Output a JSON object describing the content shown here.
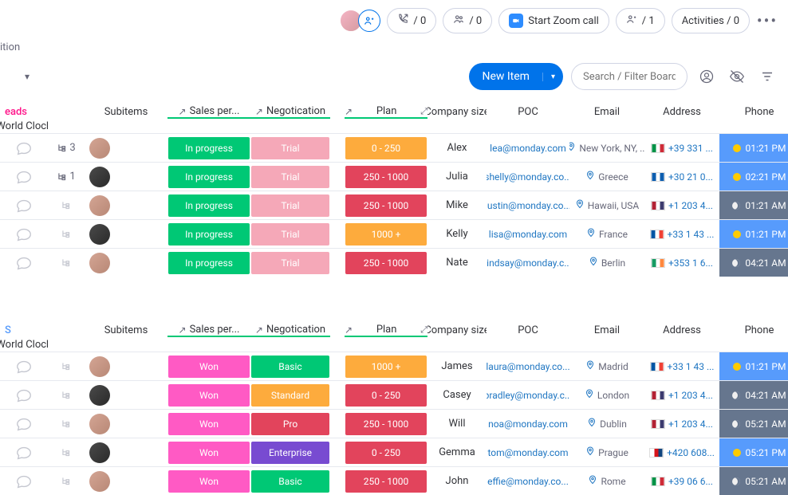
{
  "topbar": {
    "call_count": "/ 0",
    "people_count": "/ 0",
    "zoom_label": "Start Zoom call",
    "assign_count": "/ 1",
    "activities": "Activities / 0"
  },
  "sub_label": "ition",
  "controls": {
    "new_item": "New Item",
    "search_placeholder": "Search / Filter Board"
  },
  "headers": {
    "subitems": "Subitems",
    "sales": "Sales per...",
    "negotiation": "Negotication",
    "plan": "Plan",
    "company": "Company size",
    "poc": "POC",
    "email": "Email",
    "address": "Address",
    "phone": "Phone",
    "clock": "World Clock"
  },
  "groups": [
    {
      "title": "eads",
      "title_color": "#ff158a",
      "rows": [
        {
          "sub": "3",
          "pvar": "",
          "neg": "In progress",
          "negc": "#00c875",
          "plan": "Trial",
          "planc": "#f5a8b8",
          "size": "0 - 250",
          "sizec": "#fdab3d",
          "poc": "Alex",
          "email": "lea@monday.com",
          "addr": "New York, NY, ...",
          "flag": "#009246,#fff,#ce2b37",
          "phone": "+39 331 ...",
          "clock": "01:21 PM",
          "day": true
        },
        {
          "sub": "1",
          "pvar": "b",
          "neg": "In progress",
          "negc": "#00c875",
          "plan": "Trial",
          "planc": "#f5a8b8",
          "size": "250 - 1000",
          "sizec": "#e2445c",
          "poc": "Julia",
          "email": "shelly@monday.co...",
          "addr": "Greece",
          "flag": "#0d5eaf,#fff,#0d5eaf",
          "phone": "+30 21 0...",
          "clock": "02:21 PM",
          "day": true
        },
        {
          "sub": "",
          "pvar": "",
          "neg": "In progress",
          "negc": "#00c875",
          "plan": "Trial",
          "planc": "#f5a8b8",
          "size": "250 - 1000",
          "sizec": "#e2445c",
          "poc": "Mike",
          "email": "justin@monday.co...",
          "addr": "Hawaii, USA",
          "flag": "#b22234,#fff,#3c3b6e",
          "phone": "+1 203 4...",
          "clock": "01:21 AM",
          "day": false
        },
        {
          "sub": "",
          "pvar": "b",
          "neg": "In progress",
          "negc": "#00c875",
          "plan": "Trial",
          "planc": "#f5a8b8",
          "size": "1000 +",
          "sizec": "#fdab3d",
          "poc": "Kelly",
          "email": "lisa@monday.com",
          "addr": "France",
          "flag": "#0055a4,#fff,#ef4135",
          "phone": "+33 1 43 ...",
          "clock": "01:21 PM",
          "day": true
        },
        {
          "sub": "",
          "pvar": "",
          "neg": "In progress",
          "negc": "#00c875",
          "plan": "Trial",
          "planc": "#f5a8b8",
          "size": "250 - 1000",
          "sizec": "#e2445c",
          "poc": "Nate",
          "email": "lindsay@monday.c...",
          "addr": "Berlin",
          "flag": "#169b62,#fff,#ff883e",
          "phone": "+353 1 6...",
          "clock": "04:21 AM",
          "day": false
        }
      ]
    },
    {
      "title": "S",
      "title_color": "#579bfc",
      "rows": [
        {
          "sub": "",
          "pvar": "",
          "neg": "Won",
          "negc": "#ff5ac4",
          "plan": "Basic",
          "planc": "#00c875",
          "size": "1000 +",
          "sizec": "#fdab3d",
          "poc": "James",
          "email": "laura@monday.co...",
          "addr": "Madrid",
          "flag": "#0055a4,#fff,#ef4135",
          "phone": "+33 1 43 ...",
          "clock": "01:21 PM",
          "day": true
        },
        {
          "sub": "",
          "pvar": "b",
          "neg": "Won",
          "negc": "#ff5ac4",
          "plan": "Standard",
          "planc": "#fdab3d",
          "size": "0 - 250",
          "sizec": "#e2445c",
          "poc": "Casey",
          "email": "bradley@monday.c...",
          "addr": "London",
          "flag": "#b22234,#fff,#3c3b6e",
          "phone": "+1 203 4...",
          "clock": "04:21 AM",
          "day": false
        },
        {
          "sub": "",
          "pvar": "",
          "neg": "Won",
          "negc": "#ff5ac4",
          "plan": "Pro",
          "planc": "#e2445c",
          "size": "250 - 1000",
          "sizec": "#e2445c",
          "poc": "Will",
          "email": "noa@monday.com",
          "addr": "Dublin",
          "flag": "#b22234,#fff,#3c3b6e",
          "phone": "+1 203 4...",
          "clock": "05:21 AM",
          "day": false
        },
        {
          "sub": "",
          "pvar": "b",
          "neg": "Won",
          "negc": "#ff5ac4",
          "plan": "Enterprise",
          "planc": "#784bd1",
          "size": "0 - 250",
          "sizec": "#e2445c",
          "poc": "Gemma",
          "email": "tom@monday.com",
          "addr": "Prague",
          "flag": "#fff,#d7141a,#11457e",
          "phone": "+420 608...",
          "clock": "05:21 PM",
          "day": true
        },
        {
          "sub": "",
          "pvar": "",
          "neg": "Won",
          "negc": "#ff5ac4",
          "plan": "Basic",
          "planc": "#00c875",
          "size": "250 - 1000",
          "sizec": "#e2445c",
          "poc": "John",
          "email": "effie@monday.co...",
          "addr": "Rome",
          "flag": "#009246,#fff,#ce2b37",
          "phone": "+39 06 6...",
          "clock": "05:21 AM",
          "day": false
        }
      ]
    }
  ]
}
